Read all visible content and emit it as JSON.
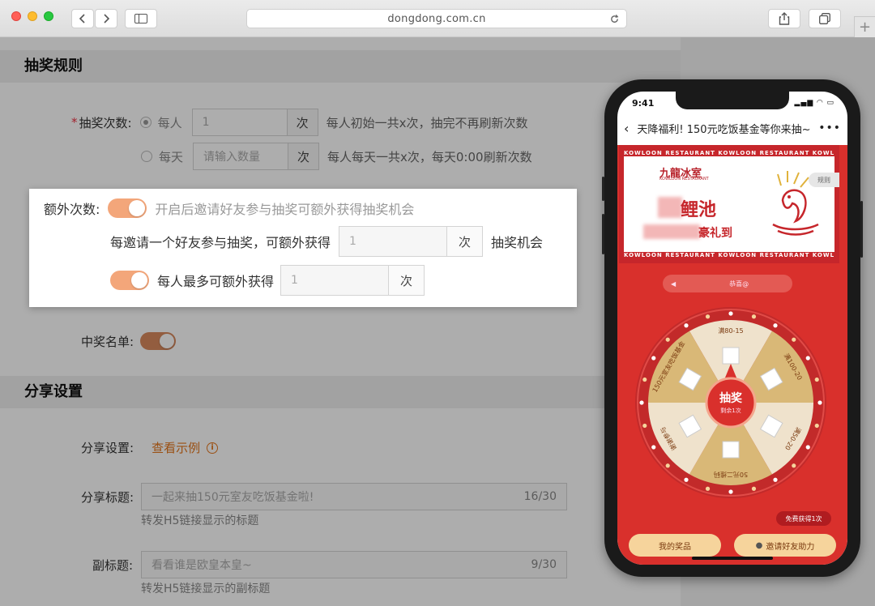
{
  "browser": {
    "url": "dongdong.com.cn",
    "back_icon": "chevron-left-icon",
    "forward_icon": "chevron-right-icon",
    "sidebar_icon": "sidebar-icon",
    "share_icon": "share-icon",
    "tabs_icon": "tabs-icon",
    "reload_icon": "reload-icon",
    "new_tab": "+"
  },
  "lottery_rules": {
    "section_title": "抽奖规则",
    "draw_times_label": "抽奖次数:",
    "per_person": {
      "option": "每人",
      "value": "1",
      "unit": "次",
      "hint": "每人初始一共x次，抽完不再刷新次数"
    },
    "per_day": {
      "option": "每天",
      "placeholder": "请输入数量",
      "unit": "次",
      "hint": "每人每天一共x次，每天0:00刷新次数"
    },
    "extra": {
      "label": "额外次数:",
      "toggle_hint": "开启后邀请好友参与抽奖可额外获得抽奖机会",
      "invite_prefix": "每邀请一个好友参与抽奖，可额外获得",
      "invite_value": "1",
      "invite_unit": "次",
      "invite_suffix": "抽奖机会",
      "max_label": "每人最多可额外获得",
      "max_value": "1",
      "max_unit": "次"
    },
    "winners_label": "中奖名单:"
  },
  "share_settings": {
    "section_title": "分享设置",
    "share_label": "分享设置:",
    "example_link": "查看示例",
    "title_label": "分享标题:",
    "title_value": "一起来抽150元室友吃饭基金啦!",
    "title_count": "16/30",
    "title_help": "转发H5链接显示的标题",
    "subtitle_label": "副标题:",
    "subtitle_value": "看看谁是欧皇本皇~",
    "subtitle_count": "9/30",
    "subtitle_help": "转发H5链接显示的副标题"
  },
  "phone": {
    "time": "9:41",
    "page_title": "天降福利! 150元吃饭基金等你来抽~",
    "banner": {
      "restaurant": "九龍冰室",
      "restaurant_en": "KOWLOON RESTAURANT",
      "strip_text": "KOWLOON RESTAURANT KOWLOON RESTAURANT KOWLOON",
      "big_text": "鲤池",
      "mid_text": "豪礼到",
      "rules_btn": "规则"
    },
    "ticker": "恭喜@",
    "wheel": {
      "center_label": "抽奖",
      "center_sub": "剩余1次",
      "prizes": [
        "满80-15",
        "满100-20",
        "满50-20",
        "50元二维码",
        "谢谢参与",
        "150元室友吃饭基金"
      ]
    },
    "free_badge": "免费获得1次",
    "my_prizes": "我的奖品",
    "invite_btn": "邀请好友助力"
  },
  "colors": {
    "accent": "#e4761d",
    "toggle": "#f3a67a",
    "phone_red": "#d9302c",
    "wheel_gold": "#d9b877",
    "wheel_cream": "#efe2cc"
  }
}
